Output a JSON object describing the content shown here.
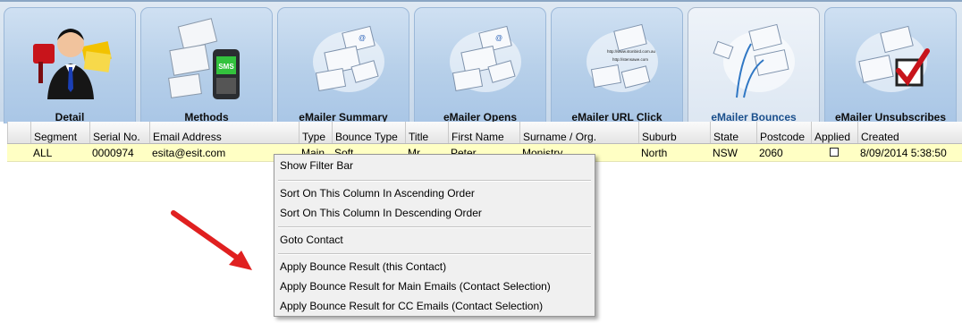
{
  "tabs": [
    {
      "label": "Detail",
      "icon": "contact-person-icon"
    },
    {
      "label": "Methods",
      "icon": "methods-sms-email-icon"
    },
    {
      "label": "eMailer Summary",
      "icon": "email-envelopes-icon"
    },
    {
      "label": "eMailer Opens",
      "icon": "email-envelopes-icon"
    },
    {
      "label": "eMailer URL Click",
      "icon": "email-url-icon"
    },
    {
      "label": "eMailer Bounces",
      "icon": "email-bounce-icon"
    },
    {
      "label": "eMailer Unsubscribes",
      "icon": "email-unsubscribe-checkbox-icon"
    }
  ],
  "active_tab": "eMailer Bounces",
  "url_icon_text": [
    "http://www.stonbird.com.au",
    "http://stensawe.com"
  ],
  "grid": {
    "columns": [
      "Segment",
      "Serial No.",
      "Email Address",
      "Type",
      "Bounce Type",
      "Title",
      "First Name",
      "Surname / Org.",
      "Suburb",
      "State",
      "Postcode",
      "Applied",
      "Created"
    ],
    "row": {
      "segment": "ALL",
      "serial": "0000974",
      "email": "esita@esit.com",
      "type": "Main",
      "bounce_type": "Soft",
      "title": "Mr",
      "first_name": "Peter",
      "surname": "Monistry",
      "suburb": "North",
      "state": "NSW",
      "postcode": "2060",
      "applied": false,
      "created": "8/09/2014 5:38:50"
    },
    "row_color": "#ffffc4"
  },
  "context_menu": {
    "items": [
      "Show Filter Bar",
      "Sort On This Column In Ascending Order",
      "Sort On This Column In Descending Order",
      "Goto Contact",
      "Apply Bounce Result (this Contact)",
      "Apply Bounce Result for Main Emails (Contact Selection)",
      "Apply Bounce Result for CC Emails (Contact Selection)"
    ]
  },
  "annotation_arrow_color": "#e02020"
}
